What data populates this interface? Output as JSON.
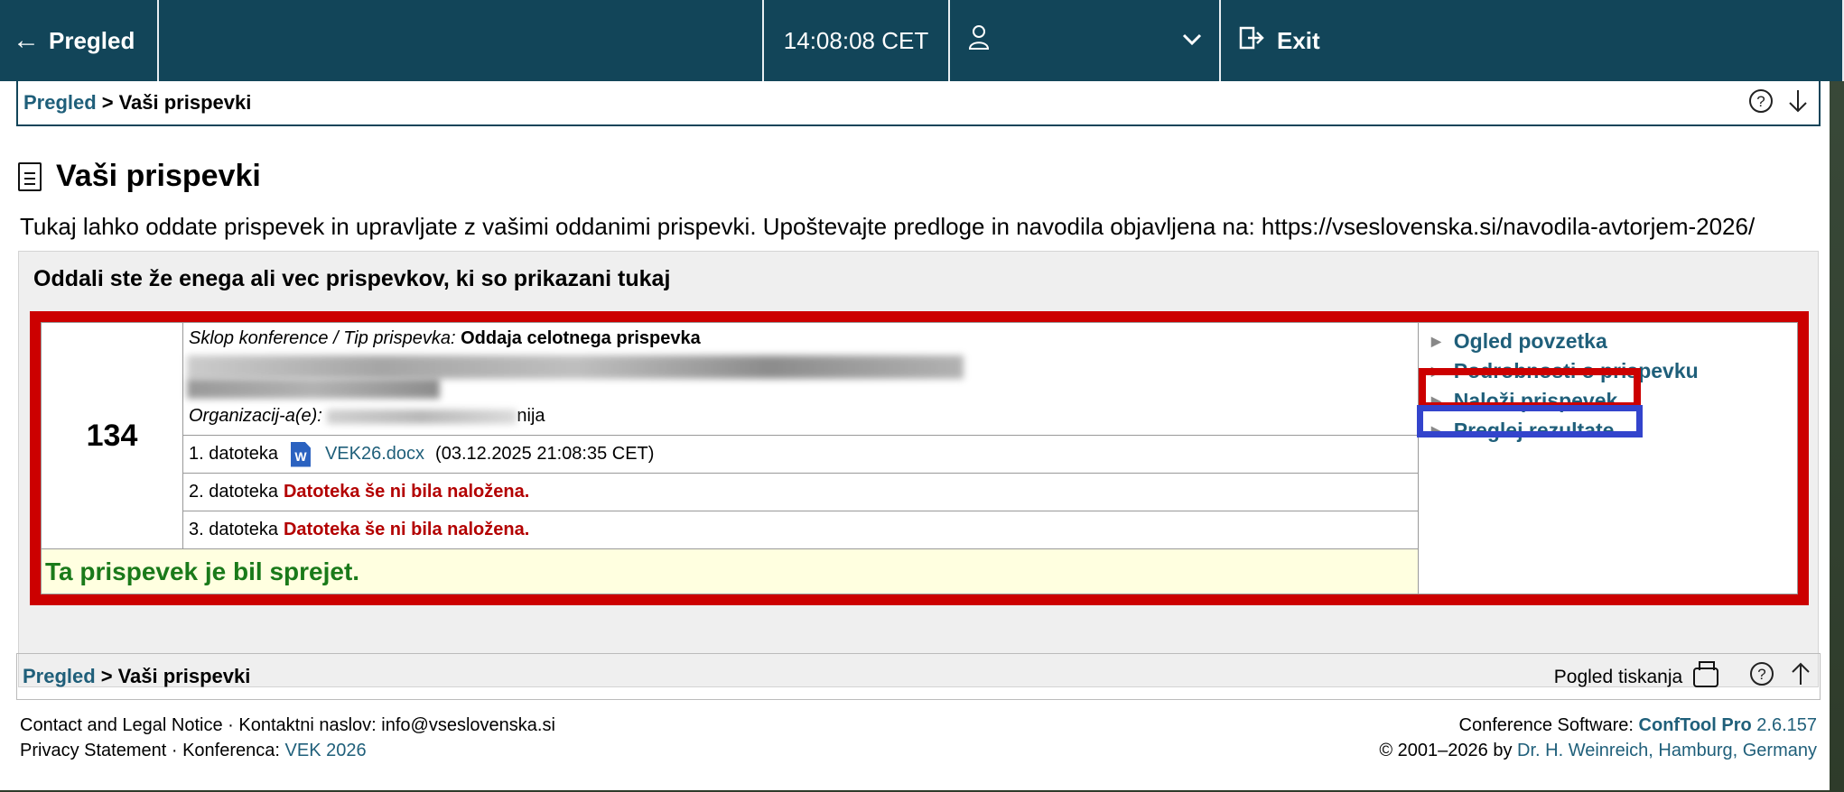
{
  "topbar": {
    "back_label": "Pregled",
    "clock": "14:08:08 CET",
    "exit_label": "Exit"
  },
  "breadcrumb": {
    "link": "Pregled",
    "separator": ">",
    "current": "Vaši prispevki"
  },
  "page": {
    "title": "Vaši prispevki",
    "intro": "Tukaj lahko oddate prispevek in upravljate z vašimi oddanimi prispevki. Upoštevajte predloge in navodila objavljena na: https://vseslovenska.si/navodila-avtorjem-2026/"
  },
  "panel": {
    "heading": "Oddali ste že enega ali vec prispevkov, ki so prikazani tukaj"
  },
  "submission": {
    "number": "134",
    "track_label": "Sklop konference / Tip prispevka:",
    "track_value": "Oddaja celotnega prispevka",
    "org_label": "Organizacij-a(e):",
    "org_suffix": "nija",
    "files": [
      {
        "label": "1. datoteka",
        "name": "VEK26.docx",
        "date": "(03.12.2025 21:08:35 CET)"
      },
      {
        "label": "2. datoteka",
        "status": "Datoteka še ni bila naložena."
      },
      {
        "label": "3. datoteka",
        "status": "Datoteka še ni bila naložena."
      }
    ],
    "accepted": "Ta prispevek je bil sprejet.",
    "actions": [
      "Ogled povzetka",
      "Podrobnosti o prispevku",
      "Naloži prispevek",
      "Preglej rezultate"
    ]
  },
  "bottom_bar": {
    "print_label": "Pogled tiskanja"
  },
  "footer": {
    "contact": "Contact and Legal Notice",
    "contact_address_label": "Kontaktni naslov:",
    "contact_email": "info@vseslovenska.si",
    "privacy": "Privacy Statement",
    "conference_label": "Konferenca:",
    "conference_name": "VEK 2026",
    "software_label": "Conference Software:",
    "software_name": "ConfTool Pro",
    "software_version": "2.6.157",
    "copyright_prefix": "© 2001–2026 by",
    "copyright_author": "Dr. H. Weinreich, Hamburg, Germany",
    "dot": "·"
  },
  "colors": {
    "topbar_bg": "#124559",
    "link": "#1f5f7a",
    "error": "#b30000",
    "accepted": "#1a7a1a",
    "highlight_red": "#cc0000",
    "highlight_blue": "#3344cc"
  },
  "icons": {
    "back": "arrow-left-icon",
    "user": "user-icon",
    "dropdown": "chevron-down-icon",
    "exit": "exit-icon",
    "help": "help-circle-icon",
    "scroll_down": "arrow-down-icon",
    "scroll_up": "arrow-up-icon",
    "document": "document-icon",
    "word": "word-file-icon",
    "print": "printer-icon"
  }
}
